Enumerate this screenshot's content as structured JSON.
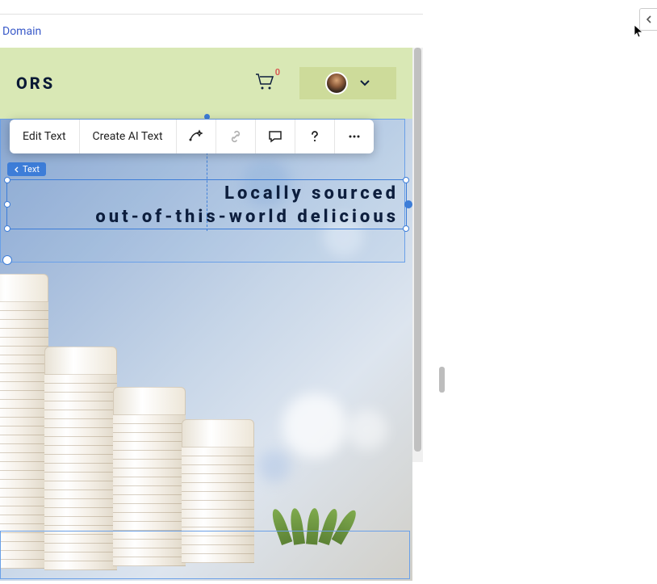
{
  "topbar": {
    "domain_link": "Domain"
  },
  "header": {
    "brand_fragment": "ORS",
    "cart_count": "0"
  },
  "toolbar": {
    "edit_text": "Edit Text",
    "create_ai_text": "Create AI Text"
  },
  "selection": {
    "tag_label": "Text"
  },
  "hero": {
    "line1": "Locally sourced",
    "line2": "out-of-this-world delicious"
  }
}
